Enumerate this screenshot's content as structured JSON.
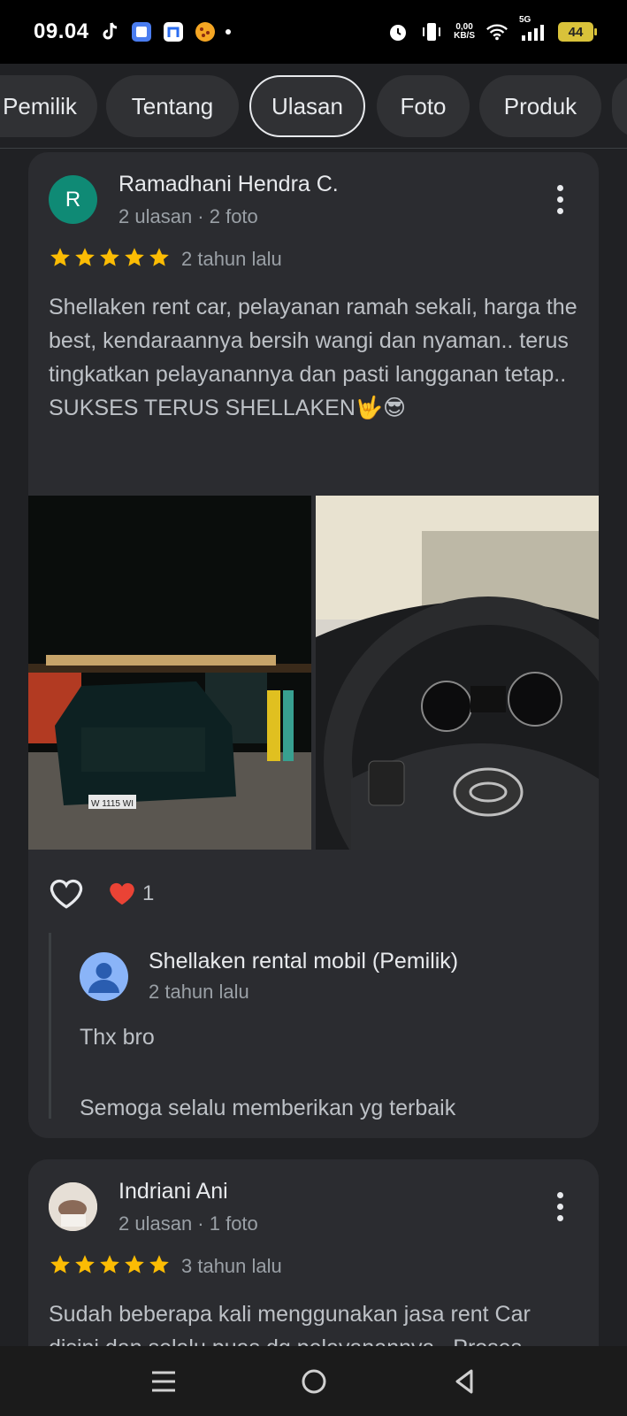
{
  "status_bar": {
    "time": "09.04",
    "net_speed_value": "0,00",
    "net_speed_unit": "KB/S",
    "network": "5G",
    "battery": "44"
  },
  "tabs": [
    {
      "label": "Pemilik"
    },
    {
      "label": "Tentang"
    },
    {
      "label": "Ulasan",
      "active": true
    },
    {
      "label": "Foto"
    },
    {
      "label": "Produk"
    }
  ],
  "reviews": [
    {
      "avatar_letter": "R",
      "avatar_color": "#0f8a75",
      "name": "Ramadhani Hendra C.",
      "meta": "2 ulasan · 2 foto",
      "rating": 5,
      "date": "2 tahun lalu",
      "text": "Shellaken rent car, pelayanan ramah sekali, harga the best, kendaraannya bersih wangi dan nyaman.. terus tingkatkan pelayanannya dan pasti langganan tetap.. SUKSES TERUS SHELLAKEN🤟😎",
      "like_count": "1",
      "photo_plate": "W 1115 WI",
      "reply": {
        "name": "Shellaken rental mobil (Pemilik)",
        "date": "2 tahun lalu",
        "text": "Thx bro\n\nSemoga selalu memberikan yg terbaik"
      }
    },
    {
      "name": "Indriani Ani",
      "meta": "2 ulasan · 1 foto",
      "rating": 5,
      "date": "3 tahun lalu",
      "text": "Sudah beberapa kali menggunakan jasa rent Car disini dan selalu puas dg pelayanannya.. Proses"
    }
  ],
  "colors": {
    "star": "#fbbc04",
    "heart": "#ea4335",
    "background": "#202124",
    "card": "#2b2c30"
  }
}
